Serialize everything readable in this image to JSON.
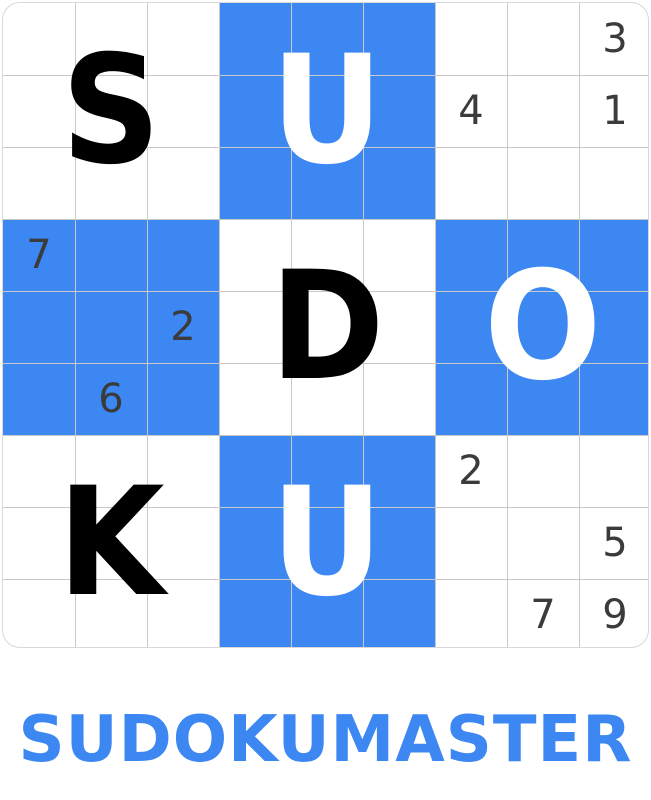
{
  "brand": {
    "name": "SUDOKUMASTER"
  },
  "colors": {
    "accent": "#3d87f3",
    "digit": "#3b3b3b",
    "letter_dark": "#000000",
    "letter_light": "#ffffff"
  },
  "board": {
    "size": 9,
    "highlighted_blocks": [
      [
        0,
        1
      ],
      [
        1,
        0
      ],
      [
        1,
        2
      ],
      [
        2,
        1
      ]
    ],
    "block_letters": [
      {
        "block": [
          0,
          0
        ],
        "letter": "S",
        "color": "dark"
      },
      {
        "block": [
          0,
          1
        ],
        "letter": "U",
        "color": "light"
      },
      {
        "block": [
          1,
          1
        ],
        "letter": "D",
        "color": "dark"
      },
      {
        "block": [
          1,
          2
        ],
        "letter": "O",
        "color": "light"
      },
      {
        "block": [
          2,
          0
        ],
        "letter": "K",
        "color": "dark"
      },
      {
        "block": [
          2,
          1
        ],
        "letter": "U",
        "color": "light"
      }
    ],
    "given_digits": [
      {
        "row": 0,
        "col": 8,
        "value": "3"
      },
      {
        "row": 1,
        "col": 6,
        "value": "4"
      },
      {
        "row": 1,
        "col": 8,
        "value": "1"
      },
      {
        "row": 3,
        "col": 0,
        "value": "7"
      },
      {
        "row": 4,
        "col": 2,
        "value": "2"
      },
      {
        "row": 5,
        "col": 1,
        "value": "6"
      },
      {
        "row": 6,
        "col": 6,
        "value": "2"
      },
      {
        "row": 7,
        "col": 8,
        "value": "5"
      },
      {
        "row": 8,
        "col": 7,
        "value": "7"
      },
      {
        "row": 8,
        "col": 8,
        "value": "9"
      }
    ]
  }
}
